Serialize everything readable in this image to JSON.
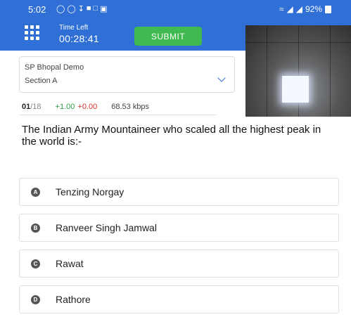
{
  "status_bar": {
    "time": "5:02",
    "battery": "92%",
    "icons": [
      "whatsapp-icon",
      "whatsapp-icon",
      "download-icon",
      "app-icon",
      "message-icon",
      "image-icon"
    ],
    "network_icons": [
      "wifi-icon",
      "signal-icon",
      "signal-icon"
    ]
  },
  "app_bar": {
    "menu_icon": "grid-menu-icon",
    "timer_label": "Time Left",
    "timer_value": "00:28:41",
    "submit_label": "SUBMIT"
  },
  "selector": {
    "exam_name": "SP Bhopal Demo",
    "section": "Section A"
  },
  "stats": {
    "current_question": "01",
    "total_questions": "/18",
    "positive_marks": "+1.00",
    "negative_marks": "+0.00",
    "speed": "68.53 kbps"
  },
  "question": {
    "text": "The Indian Army Mountaineer who scaled all the highest peak in the world is:-"
  },
  "options": [
    {
      "letter": "A",
      "text": "Tenzing Norgay"
    },
    {
      "letter": "B",
      "text": "Ranveer Singh Jamwal"
    },
    {
      "letter": "C",
      "text": "Rawat"
    },
    {
      "letter": "D",
      "text": "Rathore"
    }
  ],
  "colors": {
    "primary": "#2f6fd6",
    "submit": "#3fb950",
    "positive": "#2e9e45",
    "negative": "#d9342b"
  }
}
